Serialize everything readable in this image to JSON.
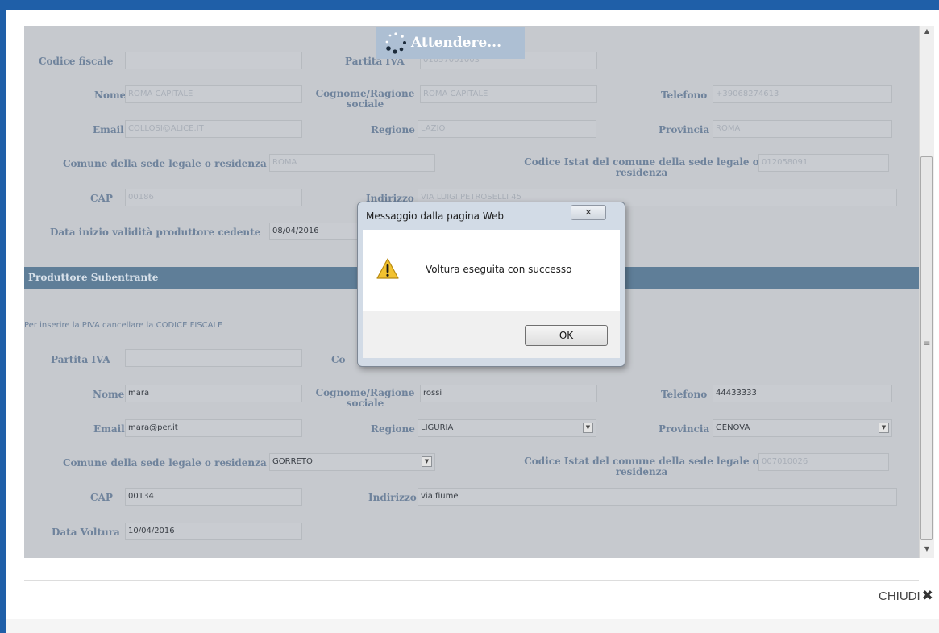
{
  "producer_previous": {
    "codice_fiscale": {
      "label": "Codice fiscale",
      "value": ""
    },
    "partita_iva": {
      "label": "Partita IVA",
      "value": "01057001003"
    },
    "nome": {
      "label": "Nome",
      "value": "ROMA CAPITALE"
    },
    "cognome": {
      "label": "Cognome/Ragione sociale",
      "value": "ROMA CAPITALE"
    },
    "telefono": {
      "label": "Telefono",
      "value": "+39068274613"
    },
    "email": {
      "label": "Email",
      "value": "COLLOSI@ALICE.IT"
    },
    "regione": {
      "label": "Regione",
      "value": "LAZIO"
    },
    "provincia": {
      "label": "Provincia",
      "value": "ROMA"
    },
    "comune": {
      "label": "Comune della sede legale o residenza",
      "value": "ROMA"
    },
    "istat": {
      "label": "Codice Istat del comune della sede legale o residenza",
      "value": "012058091"
    },
    "cap": {
      "label": "CAP",
      "value": "00186"
    },
    "indirizzo": {
      "label": "Indirizzo",
      "value": "VIA LUIGI PETROSELLI 45"
    },
    "data_inizio": {
      "label": "Data inizio validità produttore cedente",
      "value": "08/04/2016"
    }
  },
  "section_header": "Produttore Subentrante",
  "hint": "Per inserire la PIVA cancellare la CODICE FISCALE",
  "producer_new": {
    "partita_iva": {
      "label": "Partita IVA",
      "value": ""
    },
    "codice_fiscale_label": "Co",
    "nome": {
      "label": "Nome",
      "value": "mara"
    },
    "cognome": {
      "label": "Cognome/Ragione sociale",
      "value": "rossi"
    },
    "telefono": {
      "label": "Telefono",
      "value": "44433333"
    },
    "email": {
      "label": "Email",
      "value": "mara@per.it"
    },
    "regione": {
      "label": "Regione",
      "value": "LIGURIA"
    },
    "provincia": {
      "label": "Provincia",
      "value": "GENOVA"
    },
    "comune": {
      "label": "Comune della sede legale o residenza",
      "value": "GORRETO"
    },
    "istat": {
      "label": "Codice Istat del comune della sede legale o residenza",
      "value": "007010026"
    },
    "cap": {
      "label": "CAP",
      "value": "00134"
    },
    "indirizzo": {
      "label": "Indirizzo",
      "value": "via fiume"
    },
    "data_voltura": {
      "label": "Data Voltura",
      "value": "10/04/2016"
    }
  },
  "loading": {
    "text": "Attendere..."
  },
  "dialog": {
    "title": "Messaggio dalla pagina Web",
    "close_glyph": "✕",
    "message": "Voltura eseguita con successo",
    "ok_label": "OK",
    "icon": "warning-icon"
  },
  "footer": {
    "close_label": "CHIUDI",
    "close_glyph": "✖"
  },
  "scrollbar": {
    "up_glyph": "▲",
    "down_glyph": "▼",
    "grip_glyph": "≡"
  },
  "colors": {
    "brand_blue": "#1f5fa8",
    "section_header": "#5f7e98",
    "overlay": "#c6c9ce",
    "label": "#6f839c"
  }
}
